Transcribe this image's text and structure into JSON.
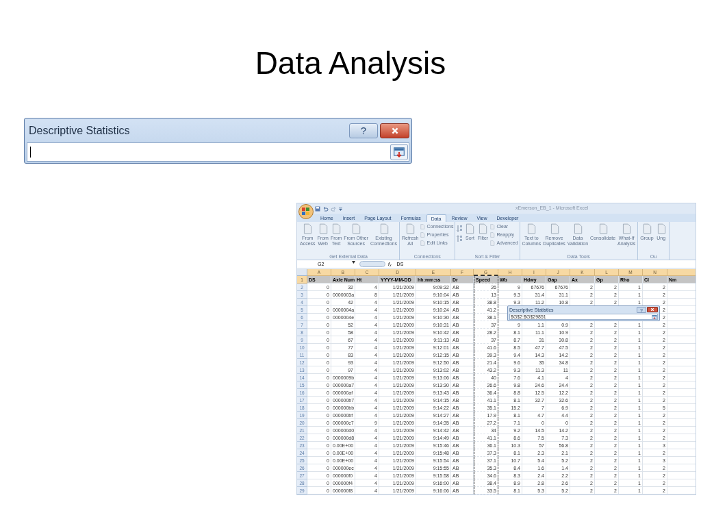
{
  "slide_title": "Data Analysis",
  "dialog": {
    "title": "Descriptive Statistics",
    "help": "?"
  },
  "excel": {
    "title": "xEmerson_EB_1 - Microsoft Excel",
    "tabs": [
      {
        "label": "Home",
        "selected": false
      },
      {
        "label": "Insert",
        "selected": false
      },
      {
        "label": "Page Layout",
        "selected": false
      },
      {
        "label": "Formulas",
        "selected": false
      },
      {
        "label": "Data",
        "selected": true
      },
      {
        "label": "Review",
        "selected": false
      },
      {
        "label": "View",
        "selected": false
      },
      {
        "label": "Developer",
        "selected": false
      }
    ],
    "ribbon_groups": [
      {
        "label": "Get External Data",
        "items": [
          {
            "kind": "large",
            "label": "From\nAccess"
          },
          {
            "kind": "large",
            "label": "From\nWeb"
          },
          {
            "kind": "large",
            "label": "From\nText"
          },
          {
            "kind": "large",
            "label": "From Other\nSources"
          },
          {
            "kind": "large",
            "label": "Existing\nConnections"
          }
        ]
      },
      {
        "label": "Connections",
        "items": [
          {
            "kind": "large",
            "label": "Refresh\nAll"
          },
          {
            "kind": "small",
            "label": "Connections"
          },
          {
            "kind": "small",
            "label": "Properties"
          },
          {
            "kind": "small",
            "label": "Edit Links"
          }
        ]
      },
      {
        "label": "Sort & Filter",
        "items": [
          {
            "kind": "icons"
          },
          {
            "kind": "large",
            "label": "Sort"
          },
          {
            "kind": "large",
            "label": "Filter"
          },
          {
            "kind": "small",
            "label": "Clear"
          },
          {
            "kind": "small",
            "label": "Reapply"
          },
          {
            "kind": "small",
            "label": "Advanced"
          }
        ]
      },
      {
        "label": "Data Tools",
        "items": [
          {
            "kind": "large",
            "label": "Text to\nColumns"
          },
          {
            "kind": "large",
            "label": "Remove\nDuplicates"
          },
          {
            "kind": "large",
            "label": "Data\nValidation"
          },
          {
            "kind": "large",
            "label": "Consolidate"
          },
          {
            "kind": "large",
            "label": "What-If\nAnalysis"
          }
        ]
      },
      {
        "label": "Ou",
        "items": [
          {
            "kind": "large",
            "label": "Group"
          },
          {
            "kind": "large",
            "label": "Ung"
          }
        ]
      }
    ],
    "name_box": "G2",
    "fx": "f$_{x}$",
    "formula": "DS",
    "columns": [
      {
        "letter": "A",
        "copied": false
      },
      {
        "letter": "B",
        "copied": false
      },
      {
        "letter": "C",
        "copied": false
      },
      {
        "letter": "D",
        "copied": false
      },
      {
        "letter": "E",
        "copied": false
      },
      {
        "letter": "F",
        "copied": false
      },
      {
        "letter": "G",
        "copied": true
      },
      {
        "letter": "H",
        "copied": false
      },
      {
        "letter": "I",
        "copied": false
      },
      {
        "letter": "J",
        "copied": false
      },
      {
        "letter": "K",
        "copied": false
      },
      {
        "letter": "L",
        "copied": false
      },
      {
        "letter": "M",
        "copied": false
      },
      {
        "letter": "N",
        "copied": false
      }
    ],
    "header_row": {
      "number": "1",
      "cells": [
        "DS",
        "Axle Num",
        "Ht",
        "YYYY-MM-DD",
        "hh:mm:ss",
        "Dr",
        "Speed",
        "Wb",
        "Hdwy",
        "Gap",
        "Ax",
        "Gp",
        "Rho",
        "Cl",
        "Nm"
      ]
    },
    "rows": [
      {
        "number": "2",
        "kind": "number",
        "cells": [
          "0",
          "32",
          "4",
          "1/21/2009",
          "9:09:32",
          "AB",
          "26",
          "9",
          "67676",
          "67676",
          "2",
          "2",
          "1",
          "2"
        ]
      },
      {
        "number": "3",
        "kind": "text",
        "cells": [
          "0",
          "0000003a",
          "8",
          "1/21/2009",
          "9:10:04",
          "AB",
          "13",
          "9.3",
          "31.4",
          "31.1",
          "2",
          "2",
          "1",
          "2"
        ]
      },
      {
        "number": "4",
        "kind": "number",
        "cells": [
          "0",
          "42",
          "4",
          "1/21/2009",
          "9:10:15",
          "AB",
          "38.8",
          "9.3",
          "11.2",
          "10.8",
          "2",
          "2",
          "1",
          "2"
        ]
      },
      {
        "number": "5",
        "kind": "text",
        "cells": [
          "0",
          "0000004a",
          "4",
          "1/21/2009",
          "9:10:24",
          "AB",
          "41.2",
          null,
          null,
          null,
          null,
          null,
          null,
          "2"
        ]
      },
      {
        "number": "6",
        "kind": "text",
        "cells": [
          "0",
          "0000004e",
          "4",
          "1/21/2009",
          "9:10:30",
          "AB",
          "38.1",
          null,
          null,
          null,
          null,
          null,
          null,
          "2"
        ]
      },
      {
        "number": "7",
        "kind": "number",
        "cells": [
          "0",
          "52",
          "4",
          "1/21/2009",
          "9:10:31",
          "AB",
          "37",
          "9",
          "1.1",
          "0.9",
          "2",
          "2",
          "1",
          "2"
        ]
      },
      {
        "number": "8",
        "kind": "number",
        "cells": [
          "0",
          "58",
          "4",
          "1/21/2009",
          "9:10:42",
          "AB",
          "28.2",
          "8.1",
          "11.1",
          "10.9",
          "2",
          "2",
          "1",
          "2"
        ]
      },
      {
        "number": "9",
        "kind": "number",
        "cells": [
          "0",
          "67",
          "4",
          "1/21/2009",
          "9:11:13",
          "AB",
          "37",
          "8.7",
          "31",
          "30.8",
          "2",
          "2",
          "1",
          "2"
        ]
      },
      {
        "number": "10",
        "kind": "number",
        "cells": [
          "0",
          "77",
          "4",
          "1/21/2009",
          "9:12:01",
          "AB",
          "41.6",
          "8.5",
          "47.7",
          "47.5",
          "2",
          "2",
          "1",
          "2"
        ]
      },
      {
        "number": "11",
        "kind": "number",
        "cells": [
          "0",
          "83",
          "4",
          "1/21/2009",
          "9:12:15",
          "AB",
          "39.3",
          "9.4",
          "14.3",
          "14.2",
          "2",
          "2",
          "1",
          "2"
        ]
      },
      {
        "number": "12",
        "kind": "number",
        "cells": [
          "0",
          "93",
          "4",
          "1/21/2009",
          "9:12:50",
          "AB",
          "21.4",
          "9.6",
          "35",
          "34.8",
          "2",
          "2",
          "1",
          "2"
        ]
      },
      {
        "number": "13",
        "kind": "number",
        "cells": [
          "0",
          "97",
          "4",
          "1/21/2009",
          "9:13:02",
          "AB",
          "43.2",
          "9.3",
          "11.3",
          "11",
          "2",
          "2",
          "1",
          "2"
        ]
      },
      {
        "number": "14",
        "kind": "text",
        "cells": [
          "0",
          "0000009b",
          "4",
          "1/21/2009",
          "9:13:06",
          "AB",
          "40",
          "7.6",
          "4.1",
          "4",
          "2",
          "2",
          "1",
          "2"
        ]
      },
      {
        "number": "15",
        "kind": "text",
        "cells": [
          "0",
          "000000a7",
          "4",
          "1/21/2009",
          "9:13:30",
          "AB",
          "26.6",
          "9.8",
          "24.6",
          "24.4",
          "2",
          "2",
          "1",
          "2"
        ]
      },
      {
        "number": "16",
        "kind": "text",
        "cells": [
          "0",
          "000000af",
          "4",
          "1/21/2009",
          "9:13:43",
          "AB",
          "36.4",
          "8.8",
          "12.5",
          "12.2",
          "2",
          "2",
          "1",
          "2"
        ]
      },
      {
        "number": "17",
        "kind": "text",
        "cells": [
          "0",
          "000000b7",
          "4",
          "1/21/2009",
          "9:14:15",
          "AB",
          "41.1",
          "8.1",
          "32.7",
          "32.6",
          "2",
          "2",
          "1",
          "2"
        ]
      },
      {
        "number": "18",
        "kind": "text",
        "cells": [
          "0",
          "000000bb",
          "4",
          "1/21/2009",
          "9:14:22",
          "AB",
          "35.1",
          "15.2",
          "7",
          "6.9",
          "2",
          "2",
          "1",
          "5"
        ]
      },
      {
        "number": "19",
        "kind": "text",
        "cells": [
          "0",
          "000000bf",
          "4",
          "1/21/2009",
          "9:14:27",
          "AB",
          "17.9",
          "8.1",
          "4.7",
          "4.4",
          "2",
          "2",
          "1",
          "2"
        ]
      },
      {
        "number": "20",
        "kind": "text",
        "cells": [
          "0",
          "000000c7",
          "9",
          "1/21/2009",
          "9:14:35",
          "AB",
          "27.2",
          "7.1",
          "0",
          "0",
          "2",
          "2",
          "1",
          "2"
        ]
      },
      {
        "number": "21",
        "kind": "text",
        "cells": [
          "0",
          "000000d0",
          "4",
          "1/21/2009",
          "9:14:42",
          "AB",
          "34",
          "9.2",
          "14.5",
          "14.2",
          "2",
          "2",
          "1",
          "2"
        ]
      },
      {
        "number": "22",
        "kind": "text",
        "cells": [
          "0",
          "000000d8",
          "4",
          "1/21/2009",
          "9:14:49",
          "AB",
          "41.1",
          "8.6",
          "7.5",
          "7.3",
          "2",
          "2",
          "1",
          "2"
        ]
      },
      {
        "number": "23",
        "kind": "number",
        "cells": [
          "0",
          "0.00E+00",
          "4",
          "1/21/2009",
          "9:15:46",
          "AB",
          "36.1",
          "10.3",
          "57",
          "56.8",
          "2",
          "2",
          "1",
          "3"
        ]
      },
      {
        "number": "24",
        "kind": "number",
        "cells": [
          "0",
          "0.00E+00",
          "4",
          "1/21/2009",
          "9:15:48",
          "AB",
          "37.3",
          "8.1",
          "2.3",
          "2.1",
          "2",
          "2",
          "1",
          "2"
        ]
      },
      {
        "number": "25",
        "kind": "number",
        "cells": [
          "0",
          "0.00E+00",
          "4",
          "1/21/2009",
          "9:15:54",
          "AB",
          "37.1",
          "10.7",
          "5.4",
          "5.2",
          "2",
          "2",
          "1",
          "3"
        ]
      },
      {
        "number": "26",
        "kind": "text",
        "cells": [
          "0",
          "000000ec",
          "4",
          "1/21/2009",
          "9:15:55",
          "AB",
          "35.3",
          "8.4",
          "1.6",
          "1.4",
          "2",
          "2",
          "1",
          "2"
        ]
      },
      {
        "number": "27",
        "kind": "text",
        "cells": [
          "0",
          "000000f0",
          "4",
          "1/21/2009",
          "9:15:58",
          "AB",
          "34.6",
          "8.3",
          "2.4",
          "2.2",
          "2",
          "2",
          "1",
          "2"
        ]
      },
      {
        "number": "28",
        "kind": "text",
        "cells": [
          "0",
          "000000f4",
          "4",
          "1/21/2009",
          "9:16:00",
          "AB",
          "38.4",
          "8.9",
          "2.8",
          "2.6",
          "2",
          "2",
          "1",
          "2"
        ]
      },
      {
        "number": "29",
        "kind": "text",
        "cells": [
          "0",
          "000000f8",
          "4",
          "1/21/2009",
          "9:16:06",
          "AB",
          "33.5",
          "8.1",
          "5.3",
          "5.2",
          "2",
          "2",
          "1",
          "2"
        ]
      }
    ],
    "mini_dialog": {
      "title": "Descriptive Statistics",
      "help": "?",
      "value": "$G$2:$G$29851"
    }
  }
}
